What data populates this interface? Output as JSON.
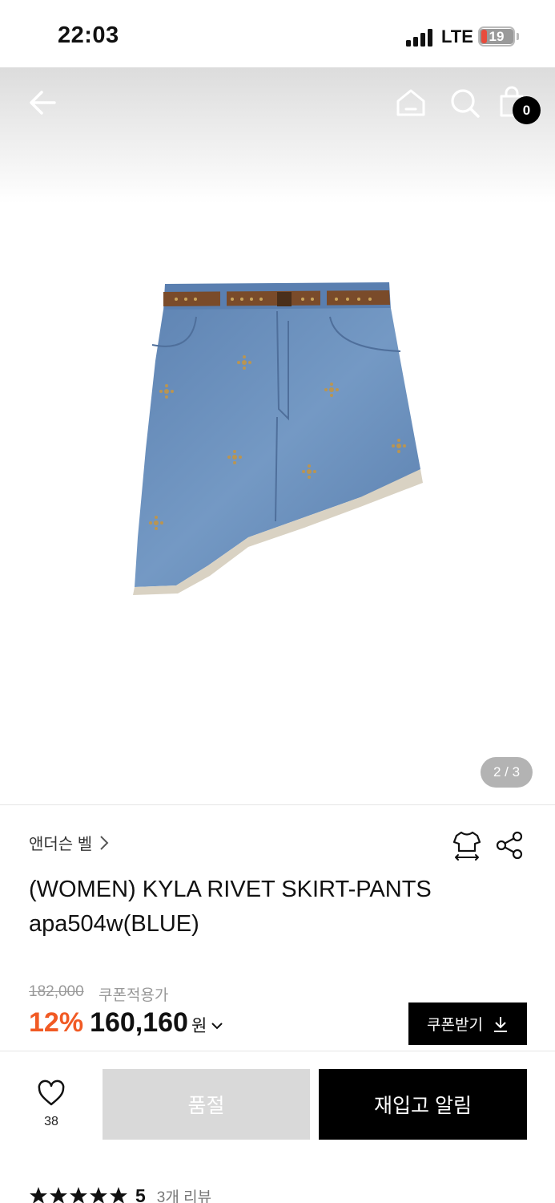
{
  "status_bar": {
    "time": "22:03",
    "network": "LTE",
    "battery": "19"
  },
  "nav": {
    "back_icon": "arrow-left-icon",
    "home_icon": "home-icon",
    "search_icon": "search-icon",
    "cart_icon": "shopping-bag-icon",
    "cart_count": "0"
  },
  "gallery": {
    "page_indicator": "2 / 3",
    "current_page": 2,
    "total_pages": 3
  },
  "product": {
    "brand": "앤더슨 벨",
    "title_line1": "(WOMEN) KYLA RIVET SKIRT-PANTS",
    "title_line2": "apa504w(BLUE)",
    "original_price": "182,000",
    "coupon_note": "쿠폰적용가",
    "discount": "12%",
    "price": "160,160",
    "currency": "원"
  },
  "actions": {
    "coupon_button": "쿠폰받기",
    "like_count": "38",
    "soldout_button": "품절",
    "restock_button": "재입고 알림"
  },
  "reviews": {
    "rating": "5",
    "stars": 5,
    "count_label": "3개 리뷰"
  },
  "colors": {
    "accent_discount": "#f15a24",
    "primary_button": "#000000",
    "disabled_button": "#d9d9d9",
    "page_indicator_bg": "#b3b3b3"
  }
}
